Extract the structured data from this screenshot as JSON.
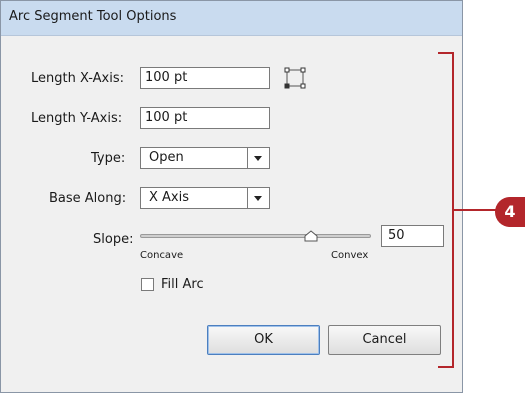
{
  "dialog": {
    "title": "Arc Segment Tool Options"
  },
  "fields": {
    "length_x_label": "Length X-Axis:",
    "length_x_value": "100 pt",
    "length_y_label": "Length Y-Axis:",
    "length_y_value": "100 pt",
    "type_label": "Type:",
    "type_value": "Open",
    "base_along_label": "Base Along:",
    "base_along_value": "X Axis",
    "slope_label": "Slope:",
    "slope_value": "50",
    "slope_position_fraction": 0.74,
    "concave_label": "Concave",
    "convex_label": "Convex",
    "fill_arc_label": "Fill Arc",
    "fill_arc_checked": false
  },
  "buttons": {
    "ok": "OK",
    "cancel": "Cancel"
  },
  "annotation": {
    "callout_number": "4",
    "color": "#b3262b"
  },
  "icons": {
    "reference_point": "reference-point-locator-icon"
  }
}
